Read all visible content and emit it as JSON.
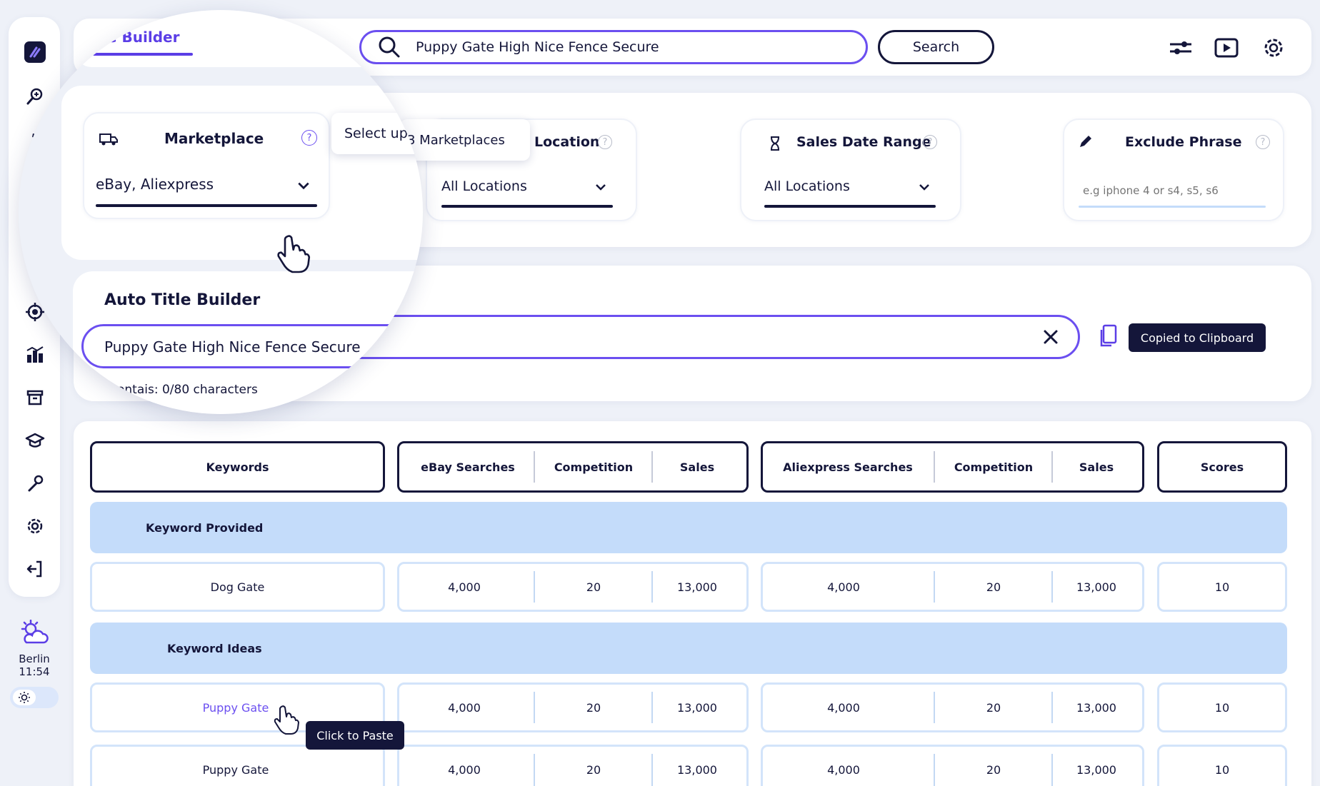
{
  "header": {
    "title": "Title Builder",
    "title_visible": "⸌e Builder",
    "search_value": "Puppy Gate High Nice Fence Secure",
    "search_button": "Search"
  },
  "sidebar": {
    "icons": [
      "logo-icon",
      "search-plus-icon",
      "hammer-icon",
      "dot-icon",
      "path-icon",
      "arrow-icon",
      "target-icon",
      "chart-icon",
      "archive-icon",
      "graduation-cap-icon",
      "wrench-icon",
      "gear-icon",
      "logout-icon"
    ]
  },
  "weather": {
    "city": "Berlin",
    "time": "11:54",
    "icon": "partly-cloudy-icon"
  },
  "filters": {
    "marketplace": {
      "title": "Marketplace",
      "value": "eBay, Aliexpress",
      "tooltip": "Select up to 3 Marketplaces",
      "tooltip_left": "Select up",
      "tooltip_right": "3 Marketplaces"
    },
    "location": {
      "title": "Location",
      "value": "All Locations"
    },
    "sales_date_range": {
      "title": "Sales Date Range",
      "value": "All Locations"
    },
    "exclude_phrase": {
      "title": "Exclude Phrase",
      "placeholder": "e.g iphone 4 or s4, s5, s6"
    }
  },
  "auto_title_builder": {
    "title": "Auto Title Builder",
    "value": "Puppy Gate High Nice Fence Secure",
    "char_count": "Contains: 0/80 characters",
    "char_count_visible": "ontais: 0/80 characters",
    "copied_label": "Copied to Clipboard"
  },
  "table": {
    "headers": {
      "keywords": "Keywords",
      "ebay": [
        "eBay Searches",
        "Competition",
        "Sales"
      ],
      "aliexpress": [
        "Aliexpress Searches",
        "Competition",
        "Sales"
      ],
      "scores": "Scores"
    },
    "sections": [
      {
        "label": "Keyword Provided",
        "rows": [
          {
            "keyword": "Dog Gate",
            "ebay": [
              "4,000",
              "20",
              "13,000"
            ],
            "aliexpress": [
              "4,000",
              "20",
              "13,000"
            ],
            "score": "10"
          }
        ]
      },
      {
        "label": "Keyword Ideas",
        "rows": [
          {
            "keyword": "Puppy Gate",
            "ebay": [
              "4,000",
              "20",
              "13,000"
            ],
            "aliexpress": [
              "4,000",
              "20",
              "13,000"
            ],
            "score": "10",
            "highlight": true
          },
          {
            "keyword": "Puppy Gate",
            "ebay": [
              "4,000",
              "20",
              "13,000"
            ],
            "aliexpress": [
              "4,000",
              "20",
              "13,000"
            ],
            "score": "10"
          }
        ]
      }
    ],
    "paste_tooltip": "Click to Paste"
  },
  "colors": {
    "accent": "#5b3ee6",
    "dark": "#14163a",
    "band": "#c4dcfa",
    "row_border": "#d3e4fa"
  }
}
